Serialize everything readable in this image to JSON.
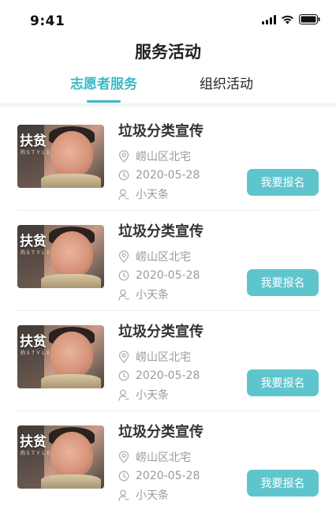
{
  "status_bar": {
    "time": "9:41"
  },
  "page": {
    "title": "服务活动"
  },
  "tabs": [
    {
      "label": "志愿者服务",
      "active": true
    },
    {
      "label": "组织活动",
      "active": false
    }
  ],
  "colors": {
    "accent": "#3fb8c4",
    "button": "#5fc5cd"
  },
  "activities": [
    {
      "image_title": "扶贫",
      "image_subtitle": "的ＳＴＹＬＥ",
      "title": "垃圾分类宣传",
      "location": "崂山区北宅",
      "date": "2020-05-28",
      "organizer": "小天条",
      "button": "我要报名"
    },
    {
      "image_title": "扶贫",
      "image_subtitle": "的ＳＴＹＬＥ",
      "title": "垃圾分类宣传",
      "location": "崂山区北宅",
      "date": "2020-05-28",
      "organizer": "小天条",
      "button": "我要报名"
    },
    {
      "image_title": "扶贫",
      "image_subtitle": "的ＳＴＹＬＥ",
      "title": "垃圾分类宣传",
      "location": "崂山区北宅",
      "date": "2020-05-28",
      "organizer": "小天条",
      "button": "我要报名"
    },
    {
      "image_title": "扶贫",
      "image_subtitle": "的ＳＴＹＬＥ",
      "title": "垃圾分类宣传",
      "location": "崂山区北宅",
      "date": "2020-05-28",
      "organizer": "小天条",
      "button": "我要报名"
    }
  ]
}
